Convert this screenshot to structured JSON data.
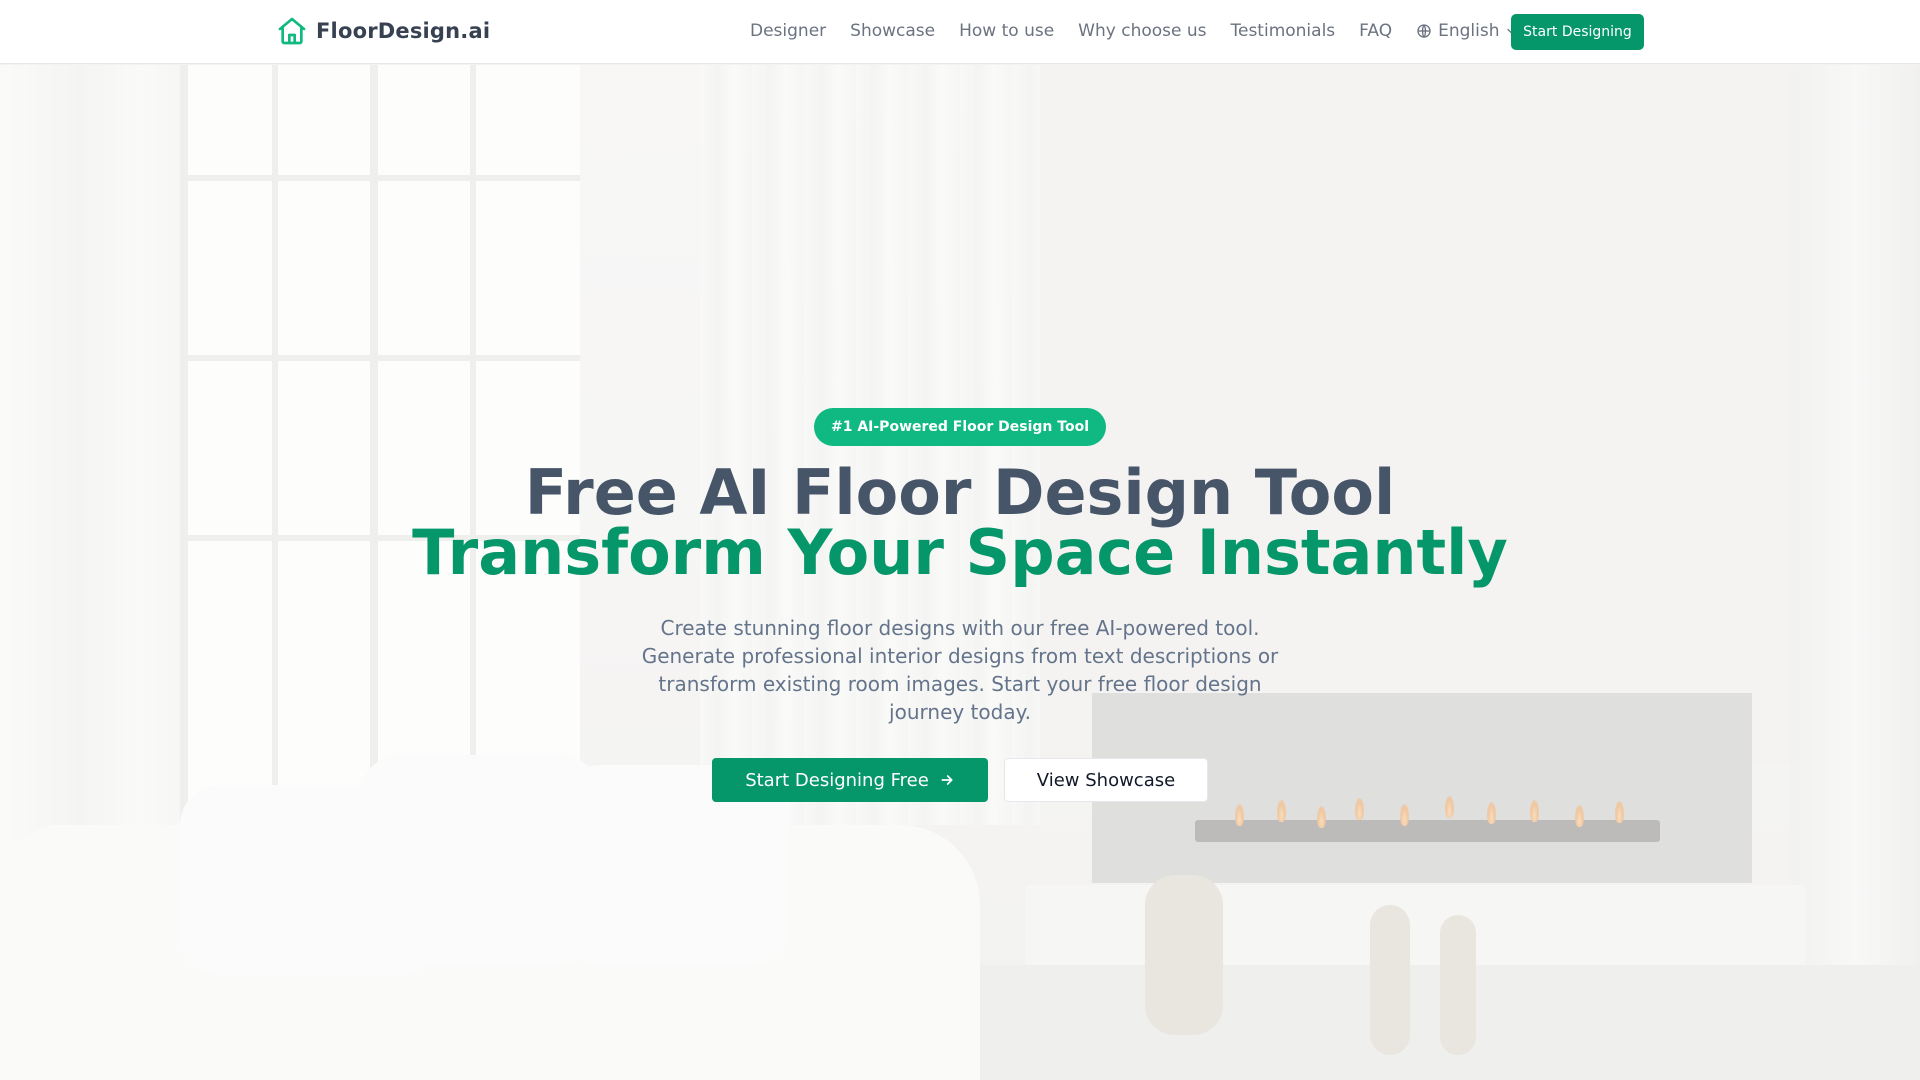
{
  "header": {
    "brand_name": "FloorDesign.ai",
    "nav": [
      {
        "label": "Designer"
      },
      {
        "label": "Showcase"
      },
      {
        "label": "How to use"
      },
      {
        "label": "Why choose us"
      },
      {
        "label": "Testimonials"
      },
      {
        "label": "FAQ"
      }
    ],
    "language": "English",
    "cta_label": "Start Designing"
  },
  "hero": {
    "badge": "#1 AI-Powered Floor Design Tool",
    "title_line1": "Free AI Floor Design Tool",
    "title_line2": "Transform Your Space Instantly",
    "subtitle": "Create stunning floor designs with our free AI-powered tool. Generate professional interior designs from text descriptions or transform existing room images. Start your free floor design journey today.",
    "primary_button": "Start Designing Free",
    "secondary_button": "View Showcase"
  },
  "colors": {
    "brand_green": "#059669",
    "badge_green": "#10b981",
    "title_slate": "#475569",
    "text_muted": "#64748b"
  },
  "icons": {
    "logo": "house-icon",
    "language": "globe-icon",
    "dropdown": "chevron-down-icon",
    "primary_button": "arrow-right-icon"
  }
}
